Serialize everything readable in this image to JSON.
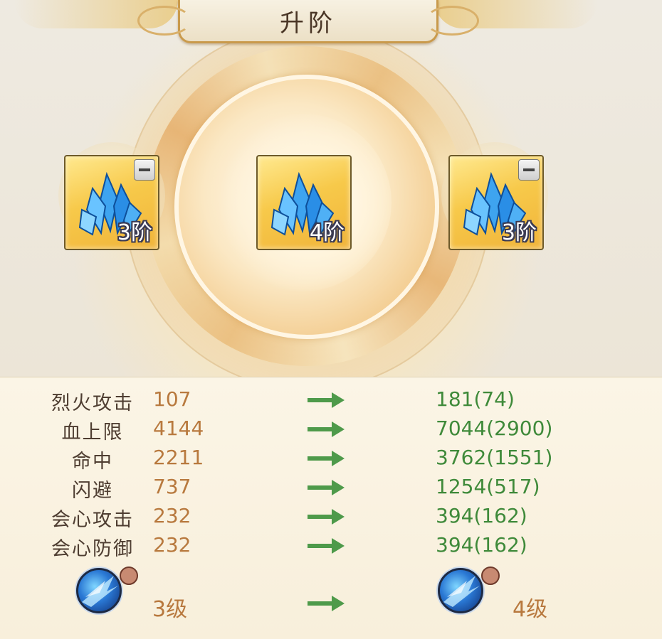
{
  "title": "升阶",
  "slots": [
    {
      "grade": "3阶",
      "icon": "blue-crystal-shard-icon"
    },
    {
      "grade": "4阶",
      "icon": "blue-crystal-shard-icon"
    },
    {
      "grade": "3阶",
      "icon": "blue-crystal-shard-icon"
    }
  ],
  "stats": [
    {
      "name": "烈火攻击",
      "current": "107",
      "next": "181(74)"
    },
    {
      "name": "血上限",
      "current": "4144",
      "next": "7044(2900)"
    },
    {
      "name": "命中",
      "current": "2211",
      "next": "3762(1551)"
    },
    {
      "name": "闪避",
      "current": "737",
      "next": "1254(517)"
    },
    {
      "name": "会心攻击",
      "current": "232",
      "next": "394(162)"
    },
    {
      "name": "会心防御",
      "current": "232",
      "next": "394(162)"
    }
  ],
  "skill": {
    "current": "3级",
    "next": "4级",
    "icon": "ice-skill-icon"
  },
  "colors": {
    "current_value": "#b8793e",
    "next_value": "#3f8a3a",
    "arrow": "#4e9a4a",
    "stat_name": "#4e3d31"
  }
}
